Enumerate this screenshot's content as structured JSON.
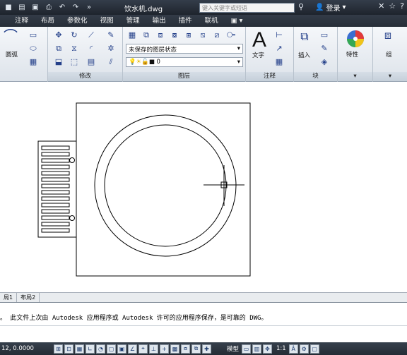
{
  "title_bar": {
    "document_title": "饮水机.dwg",
    "search_placeholder": "键入关键字或短语",
    "login_label": "登录",
    "qat_icons": [
      "new-icon",
      "open-icon",
      "save-icon",
      "print-icon",
      "undo-icon",
      "redo-icon",
      "more-icon"
    ]
  },
  "menu": {
    "tabs": [
      {
        "label": "注释"
      },
      {
        "label": "布局"
      },
      {
        "label": "参数化"
      },
      {
        "label": "视图"
      },
      {
        "label": "管理"
      },
      {
        "label": "输出"
      },
      {
        "label": "插件"
      },
      {
        "label": "联机"
      },
      {
        "label": "▣ ▾"
      }
    ]
  },
  "ribbon": {
    "draw": {
      "arc_label": "圆弧"
    },
    "modify": {
      "label": "修改"
    },
    "layers": {
      "label": "图层",
      "layer_state": "未保存的图层状态",
      "current_layer": "0"
    },
    "annotation": {
      "label": "注释",
      "text_label": "文字"
    },
    "block": {
      "label": "块",
      "insert_label": "插入"
    },
    "properties": {
      "label": "特性"
    },
    "groups": {
      "label": "组"
    }
  },
  "layout_tabs": [
    "局1",
    "布局2"
  ],
  "command_line": {
    "message": "。  此文件上次由 Autodesk 应用程序或 Autodesk 许可的应用程序保存，是可靠的 DWG。"
  },
  "status_bar": {
    "coordinates": "12, 0.0000",
    "model_label": "模型",
    "scale_label": "1:1"
  }
}
